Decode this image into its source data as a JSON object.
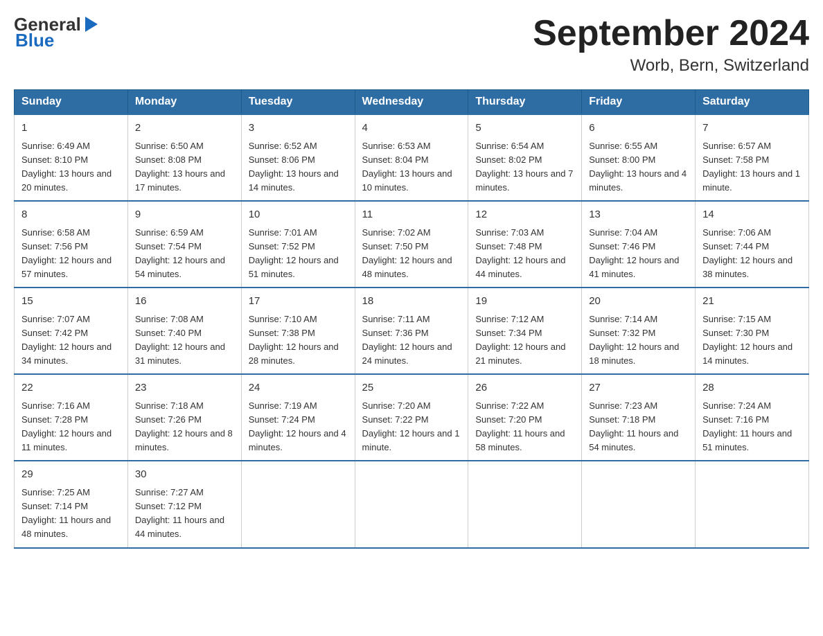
{
  "header": {
    "logo_general": "General",
    "logo_blue": "Blue",
    "month_title": "September 2024",
    "location": "Worb, Bern, Switzerland"
  },
  "days_of_week": [
    "Sunday",
    "Monday",
    "Tuesday",
    "Wednesday",
    "Thursday",
    "Friday",
    "Saturday"
  ],
  "weeks": [
    [
      {
        "day": "1",
        "sunrise": "Sunrise: 6:49 AM",
        "sunset": "Sunset: 8:10 PM",
        "daylight": "Daylight: 13 hours and 20 minutes."
      },
      {
        "day": "2",
        "sunrise": "Sunrise: 6:50 AM",
        "sunset": "Sunset: 8:08 PM",
        "daylight": "Daylight: 13 hours and 17 minutes."
      },
      {
        "day": "3",
        "sunrise": "Sunrise: 6:52 AM",
        "sunset": "Sunset: 8:06 PM",
        "daylight": "Daylight: 13 hours and 14 minutes."
      },
      {
        "day": "4",
        "sunrise": "Sunrise: 6:53 AM",
        "sunset": "Sunset: 8:04 PM",
        "daylight": "Daylight: 13 hours and 10 minutes."
      },
      {
        "day": "5",
        "sunrise": "Sunrise: 6:54 AM",
        "sunset": "Sunset: 8:02 PM",
        "daylight": "Daylight: 13 hours and 7 minutes."
      },
      {
        "day": "6",
        "sunrise": "Sunrise: 6:55 AM",
        "sunset": "Sunset: 8:00 PM",
        "daylight": "Daylight: 13 hours and 4 minutes."
      },
      {
        "day": "7",
        "sunrise": "Sunrise: 6:57 AM",
        "sunset": "Sunset: 7:58 PM",
        "daylight": "Daylight: 13 hours and 1 minute."
      }
    ],
    [
      {
        "day": "8",
        "sunrise": "Sunrise: 6:58 AM",
        "sunset": "Sunset: 7:56 PM",
        "daylight": "Daylight: 12 hours and 57 minutes."
      },
      {
        "day": "9",
        "sunrise": "Sunrise: 6:59 AM",
        "sunset": "Sunset: 7:54 PM",
        "daylight": "Daylight: 12 hours and 54 minutes."
      },
      {
        "day": "10",
        "sunrise": "Sunrise: 7:01 AM",
        "sunset": "Sunset: 7:52 PM",
        "daylight": "Daylight: 12 hours and 51 minutes."
      },
      {
        "day": "11",
        "sunrise": "Sunrise: 7:02 AM",
        "sunset": "Sunset: 7:50 PM",
        "daylight": "Daylight: 12 hours and 48 minutes."
      },
      {
        "day": "12",
        "sunrise": "Sunrise: 7:03 AM",
        "sunset": "Sunset: 7:48 PM",
        "daylight": "Daylight: 12 hours and 44 minutes."
      },
      {
        "day": "13",
        "sunrise": "Sunrise: 7:04 AM",
        "sunset": "Sunset: 7:46 PM",
        "daylight": "Daylight: 12 hours and 41 minutes."
      },
      {
        "day": "14",
        "sunrise": "Sunrise: 7:06 AM",
        "sunset": "Sunset: 7:44 PM",
        "daylight": "Daylight: 12 hours and 38 minutes."
      }
    ],
    [
      {
        "day": "15",
        "sunrise": "Sunrise: 7:07 AM",
        "sunset": "Sunset: 7:42 PM",
        "daylight": "Daylight: 12 hours and 34 minutes."
      },
      {
        "day": "16",
        "sunrise": "Sunrise: 7:08 AM",
        "sunset": "Sunset: 7:40 PM",
        "daylight": "Daylight: 12 hours and 31 minutes."
      },
      {
        "day": "17",
        "sunrise": "Sunrise: 7:10 AM",
        "sunset": "Sunset: 7:38 PM",
        "daylight": "Daylight: 12 hours and 28 minutes."
      },
      {
        "day": "18",
        "sunrise": "Sunrise: 7:11 AM",
        "sunset": "Sunset: 7:36 PM",
        "daylight": "Daylight: 12 hours and 24 minutes."
      },
      {
        "day": "19",
        "sunrise": "Sunrise: 7:12 AM",
        "sunset": "Sunset: 7:34 PM",
        "daylight": "Daylight: 12 hours and 21 minutes."
      },
      {
        "day": "20",
        "sunrise": "Sunrise: 7:14 AM",
        "sunset": "Sunset: 7:32 PM",
        "daylight": "Daylight: 12 hours and 18 minutes."
      },
      {
        "day": "21",
        "sunrise": "Sunrise: 7:15 AM",
        "sunset": "Sunset: 7:30 PM",
        "daylight": "Daylight: 12 hours and 14 minutes."
      }
    ],
    [
      {
        "day": "22",
        "sunrise": "Sunrise: 7:16 AM",
        "sunset": "Sunset: 7:28 PM",
        "daylight": "Daylight: 12 hours and 11 minutes."
      },
      {
        "day": "23",
        "sunrise": "Sunrise: 7:18 AM",
        "sunset": "Sunset: 7:26 PM",
        "daylight": "Daylight: 12 hours and 8 minutes."
      },
      {
        "day": "24",
        "sunrise": "Sunrise: 7:19 AM",
        "sunset": "Sunset: 7:24 PM",
        "daylight": "Daylight: 12 hours and 4 minutes."
      },
      {
        "day": "25",
        "sunrise": "Sunrise: 7:20 AM",
        "sunset": "Sunset: 7:22 PM",
        "daylight": "Daylight: 12 hours and 1 minute."
      },
      {
        "day": "26",
        "sunrise": "Sunrise: 7:22 AM",
        "sunset": "Sunset: 7:20 PM",
        "daylight": "Daylight: 11 hours and 58 minutes."
      },
      {
        "day": "27",
        "sunrise": "Sunrise: 7:23 AM",
        "sunset": "Sunset: 7:18 PM",
        "daylight": "Daylight: 11 hours and 54 minutes."
      },
      {
        "day": "28",
        "sunrise": "Sunrise: 7:24 AM",
        "sunset": "Sunset: 7:16 PM",
        "daylight": "Daylight: 11 hours and 51 minutes."
      }
    ],
    [
      {
        "day": "29",
        "sunrise": "Sunrise: 7:25 AM",
        "sunset": "Sunset: 7:14 PM",
        "daylight": "Daylight: 11 hours and 48 minutes."
      },
      {
        "day": "30",
        "sunrise": "Sunrise: 7:27 AM",
        "sunset": "Sunset: 7:12 PM",
        "daylight": "Daylight: 11 hours and 44 minutes."
      },
      null,
      null,
      null,
      null,
      null
    ]
  ]
}
